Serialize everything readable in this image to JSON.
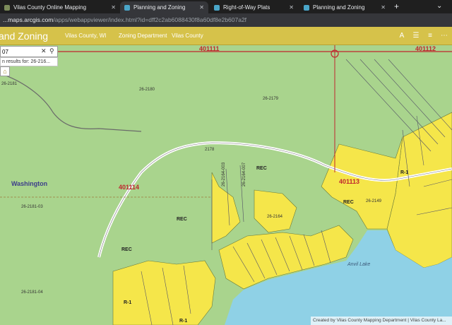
{
  "browser": {
    "tabs": [
      {
        "label": "Vilas County Online Mapping",
        "active": false
      },
      {
        "label": "Planning and Zoning",
        "active": true
      },
      {
        "label": "Right-of-Way Plats",
        "active": false
      },
      {
        "label": "Planning and Zoning",
        "active": false
      }
    ],
    "new_tab": "+",
    "window_control": "⌄",
    "url_host": "...maps.arcgis.com",
    "url_path": "/apps/webappviewer/index.html?id=dff2c2ab6088430f8a60df8e2b607a2f"
  },
  "app": {
    "title": "and Zoning",
    "county": "Vilas County, WI",
    "zoning_department": "Zoning Department",
    "vilas_county": "Vilas County"
  },
  "search": {
    "value": "07",
    "suggestion": "n results for: 26-216..."
  },
  "map": {
    "labels": {
      "section_1": "401111",
      "section_2": "401112",
      "section_3": "401114",
      "section_4": "401113",
      "town": "Washington",
      "lake": "Anvil Lake",
      "road": "2178",
      "parcels": [
        "26-2181",
        "26-2180",
        "26-2179",
        "26-2181-03",
        "26-2181-04",
        "26-2164",
        "26-2164-003",
        "26-2164-007",
        "26-2149"
      ],
      "zones": [
        "REC",
        "REC",
        "REC",
        "REC",
        "R-1",
        "R-1",
        "R-1"
      ]
    },
    "attribution": "Created by Vilas County Mapping Department | Vilas County La..."
  },
  "colors": {
    "header": "#d6c24a",
    "map_green": "#a9d48d",
    "zone_yellow": "#f5e64a",
    "water": "#8fd1e6",
    "section_line": "#c0262e"
  }
}
